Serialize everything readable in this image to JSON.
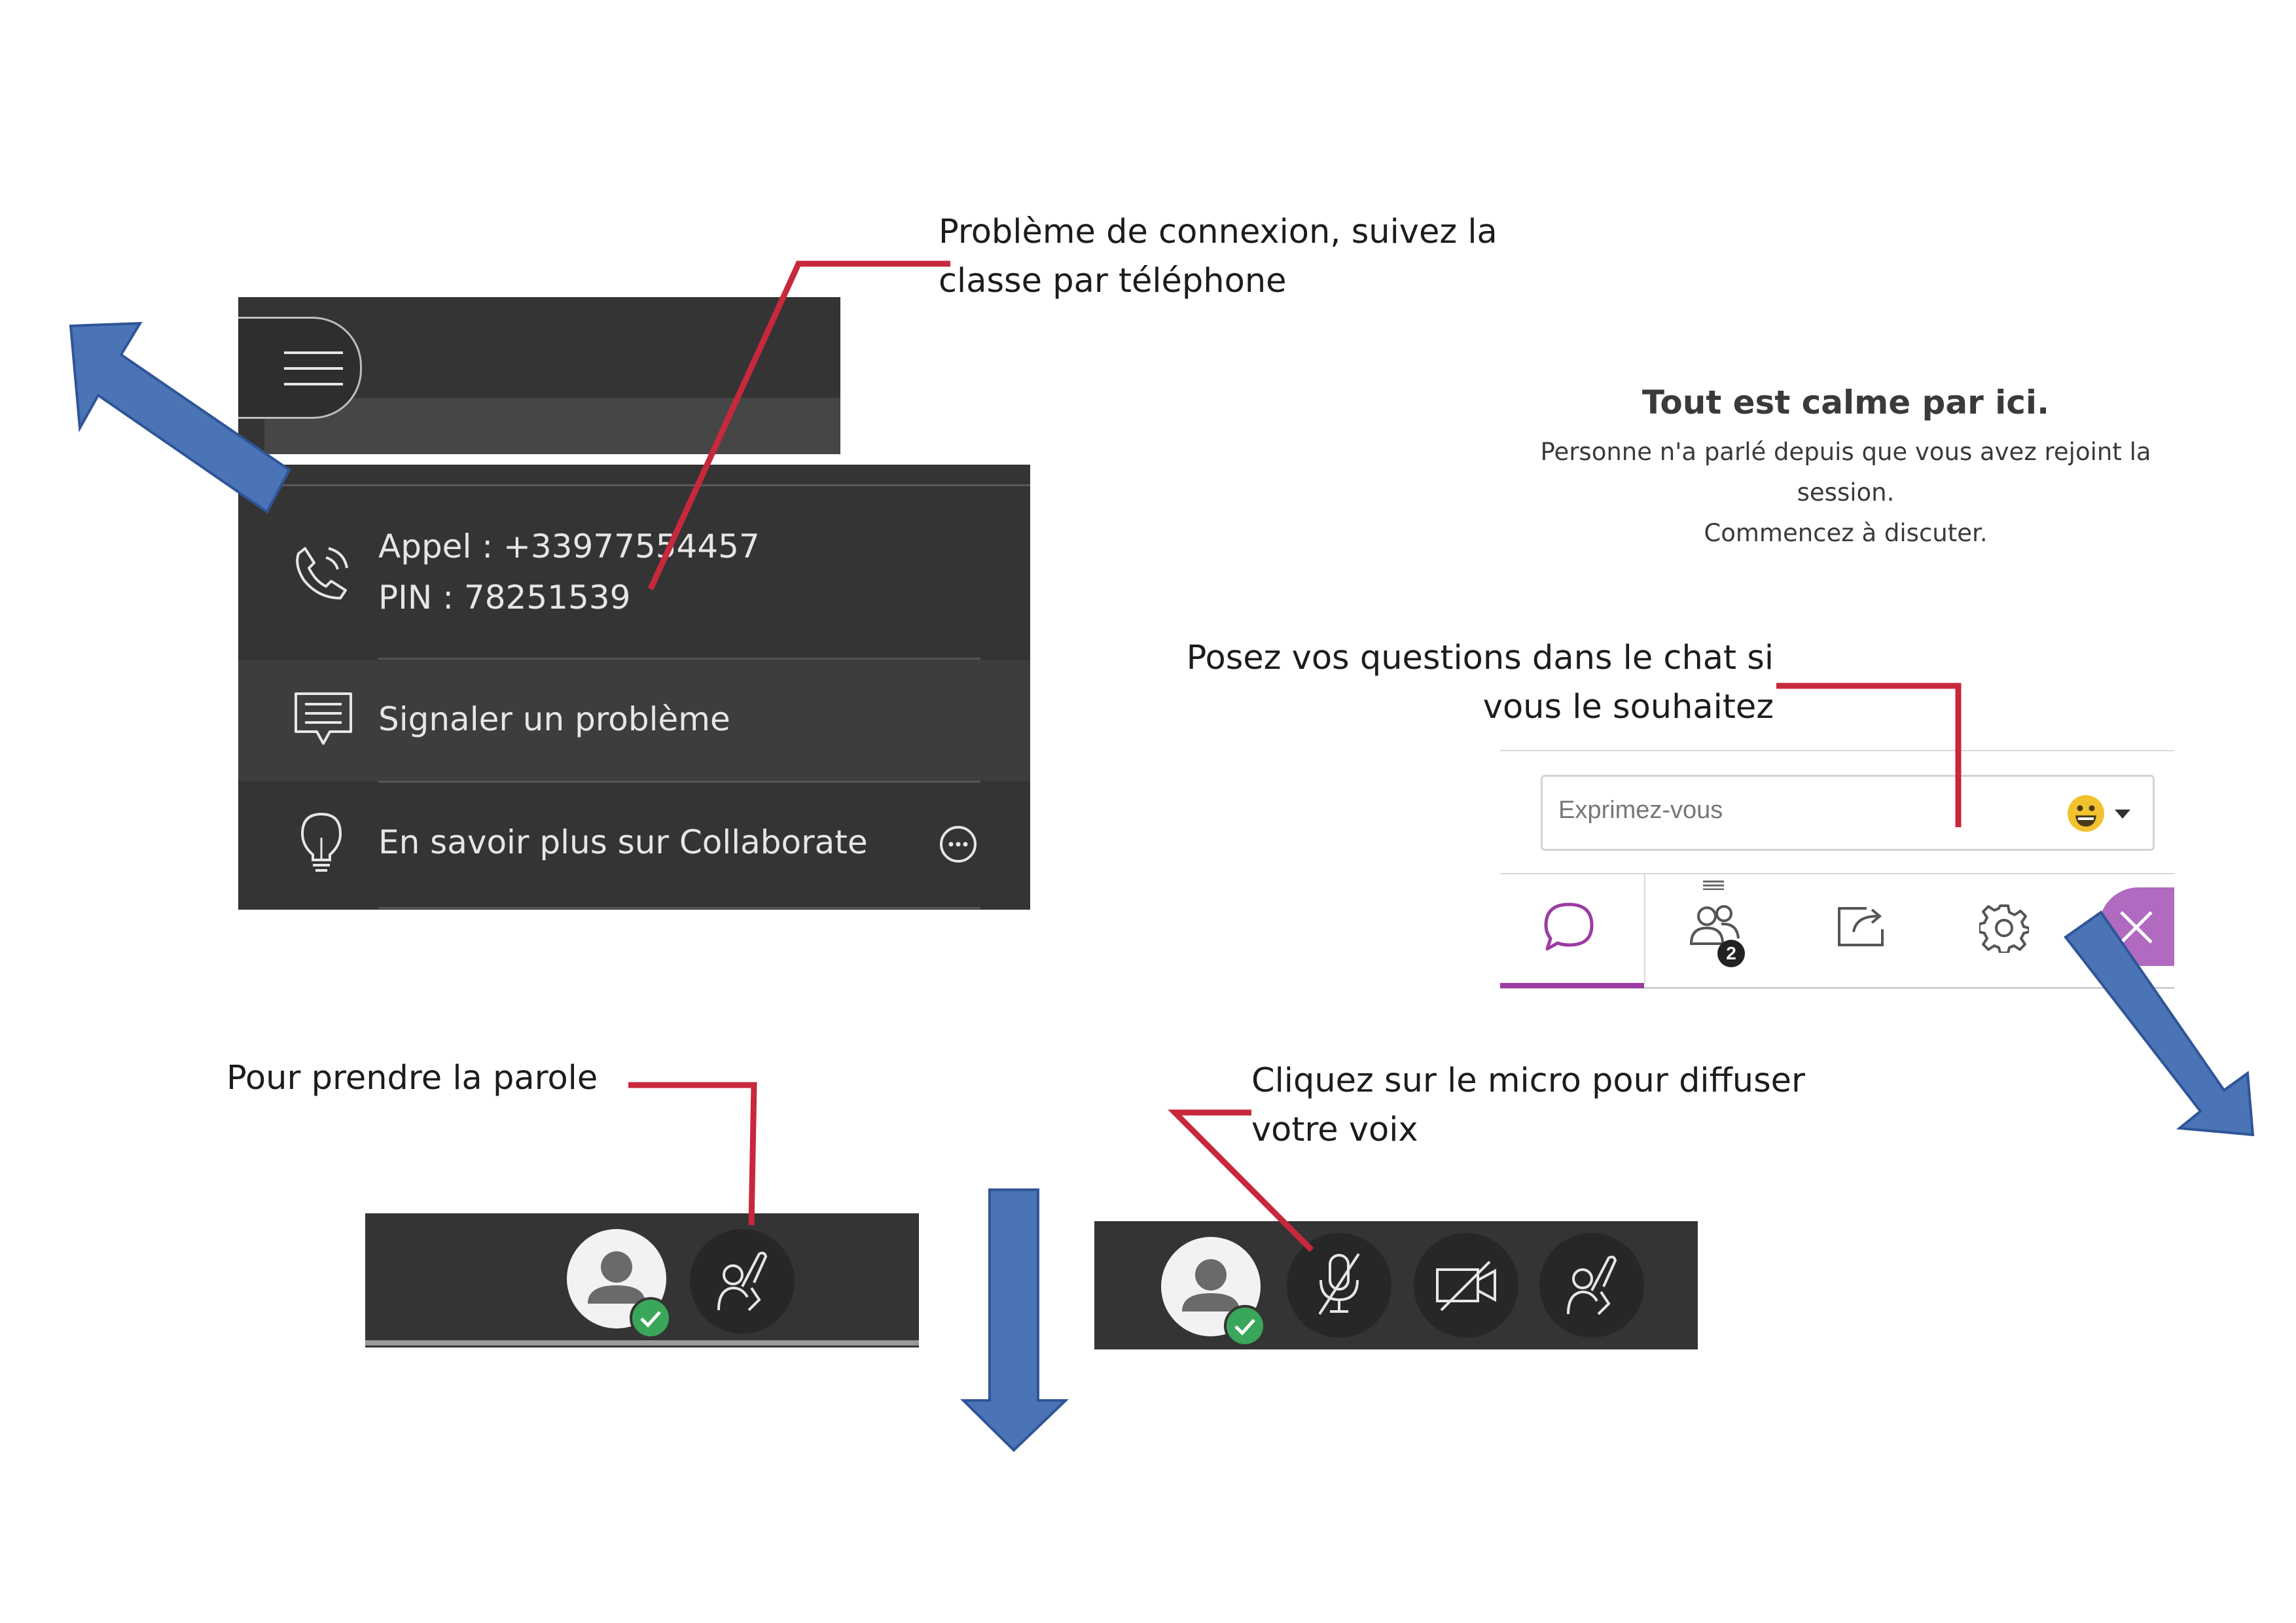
{
  "annotations": {
    "connection_problem": {
      "line1": "Problème de connexion, suivez la",
      "line2": "classe par téléphone"
    },
    "chat_questions": {
      "line1": "Posez vos questions dans le chat si",
      "line2": "vous le souhaitez"
    },
    "take_floor": "Pour prendre la parole",
    "click_mic": {
      "line1": "Cliquez sur le  micro pour diffuser",
      "line2": "votre voix"
    }
  },
  "menu": {
    "call_line": "Appel : +33977554457",
    "pin_line": "PIN : 78251539",
    "report_problem": "Signaler un problème",
    "learn_more": "En savoir plus sur Collaborate"
  },
  "chat": {
    "empty_title": "Tout est calme par ici.",
    "empty_line1": "Personne n'a parlé depuis que vous avez rejoint la",
    "empty_line2": "session.",
    "empty_line3": "Commencez à discuter.",
    "input_placeholder": "Exprimez-vous",
    "attendees_count": "2"
  },
  "colors": {
    "dark_panel": "#343434",
    "arrow_blue": "#4a74b6",
    "pointer_red": "#c8283c",
    "accent_purple": "#9b3ba3",
    "status_green": "#3aa65a"
  },
  "icons": [
    "hamburger-icon",
    "phone-icon",
    "chat-report-icon",
    "lightbulb-icon",
    "more-icon",
    "emoji-icon",
    "chat-bubble-icon",
    "attendees-icon",
    "share-icon",
    "gear-icon",
    "close-icon",
    "avatar-icon",
    "raise-hand-icon",
    "microphone-muted-icon",
    "camera-off-icon"
  ]
}
